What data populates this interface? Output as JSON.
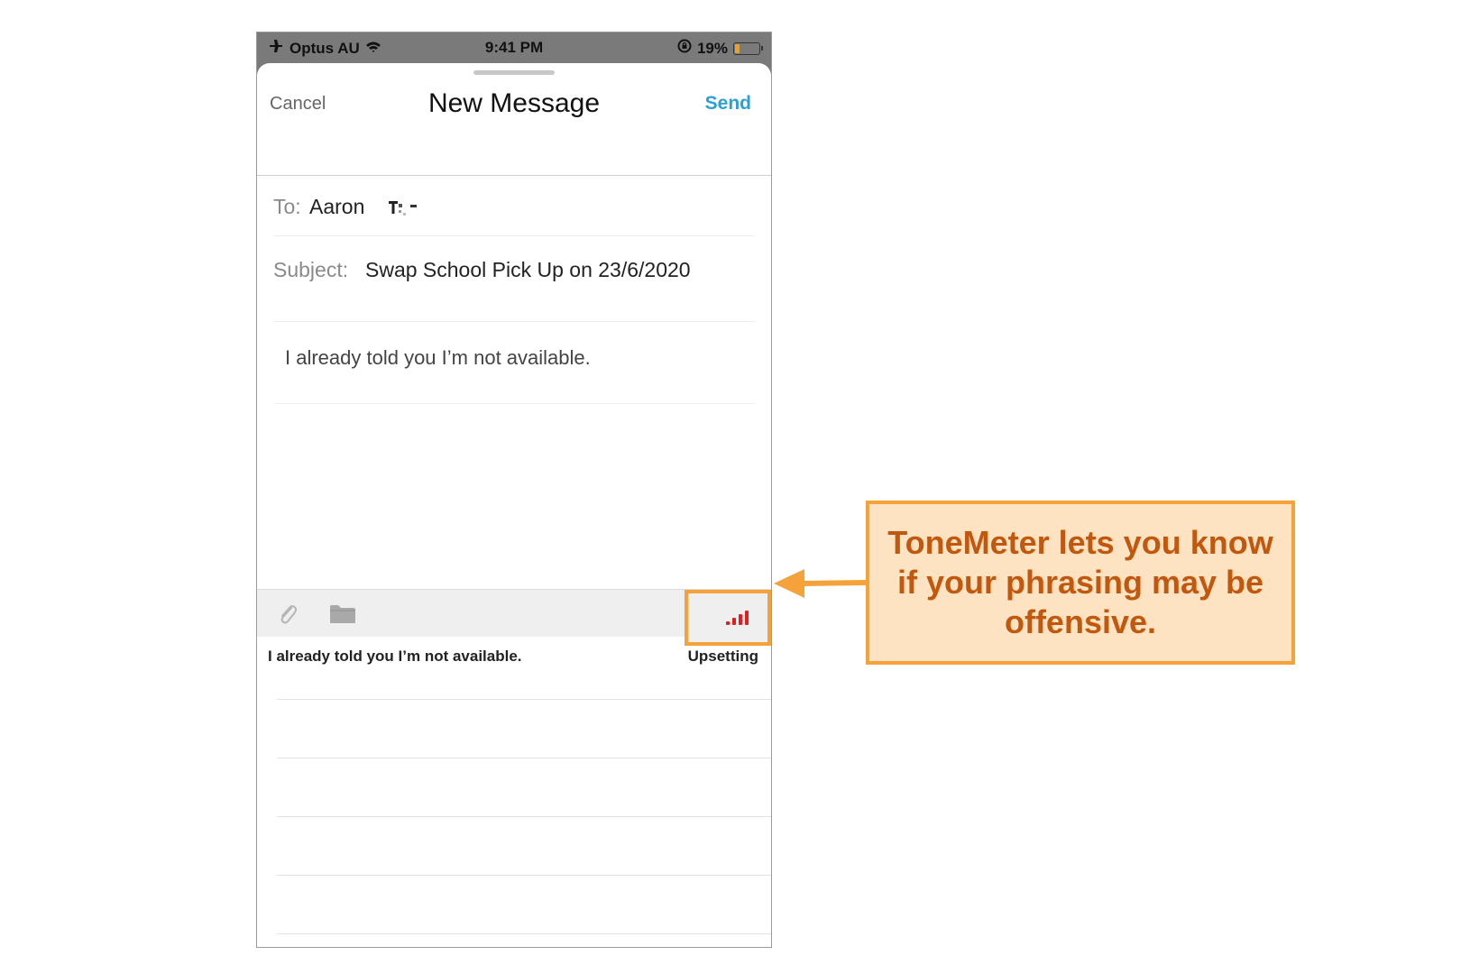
{
  "status_bar": {
    "carrier": "Optus AU",
    "time": "9:41 PM",
    "battery": "19%",
    "battery_level": 0.19,
    "battery_color": "#f0a020"
  },
  "nav": {
    "cancel_label": "Cancel",
    "title": "New Message",
    "send_label": "Send",
    "send_color": "#2aa0d8"
  },
  "compose": {
    "to_label": "To:",
    "to_value": "Aaron",
    "subject_label": "Subject:",
    "subject_value": "Swap School Pick Up on 23/6/2020",
    "body_text": "I already told you I’m not available."
  },
  "toolbar": {
    "icons": [
      "paperclip-icon",
      "folder-icon",
      "tonemeter-signal-icon"
    ],
    "tone_level": 4,
    "tone_color": "#e02020"
  },
  "tone_result": {
    "sentence": "I already told you I’m not available.",
    "tone": "Upsetting"
  },
  "callout": {
    "text": "ToneMeter lets you know if your phrasing may be offensive.",
    "border_color": "#f6a23a",
    "fill_color": "#fde3c2",
    "text_color": "#c2580e"
  }
}
